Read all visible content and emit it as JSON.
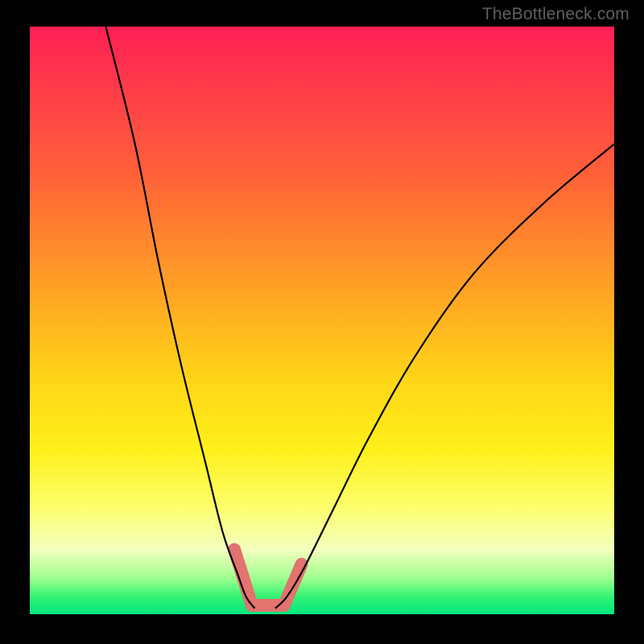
{
  "watermark": "TheBottleneck.com",
  "chart_data": {
    "type": "line",
    "title": "",
    "xlabel": "",
    "ylabel": "",
    "xlim": [
      0,
      100
    ],
    "ylim": [
      0,
      100
    ],
    "grid": false,
    "note": "V-shaped bottleneck curve on a red-to-green vertical gradient background. The plot has no visible axes or tick labels; values below are estimated from geometry (x and y as percentages of the plot box, y=0 at bottom/green, y=100 at top/red).",
    "series": [
      {
        "name": "left-branch",
        "x": [
          13.0,
          18.0,
          22.0,
          26.0,
          30.0,
          33.0,
          35.5,
          37.0,
          38.5
        ],
        "y": [
          100.0,
          80.0,
          60.0,
          42.0,
          26.0,
          14.0,
          7.0,
          3.0,
          1.0
        ]
      },
      {
        "name": "right-branch",
        "x": [
          42.0,
          44.0,
          47.0,
          52.0,
          58.0,
          66.0,
          76.0,
          88.0,
          100.0
        ],
        "y": [
          1.0,
          3.0,
          8.0,
          18.0,
          30.0,
          44.0,
          58.0,
          70.0,
          80.0
        ]
      }
    ],
    "marker_segments": {
      "note": "Thick salmon-pink marker overlay near the valley (approximate endpoints in plot-percent coords).",
      "color": "#e2736f",
      "segments": [
        {
          "x0": 35.0,
          "y0": 11.0,
          "x1": 38.0,
          "y1": 1.5
        },
        {
          "x0": 38.0,
          "y0": 1.5,
          "x1": 43.5,
          "y1": 1.5
        },
        {
          "x0": 43.5,
          "y0": 1.5,
          "x1": 46.5,
          "y1": 8.5
        }
      ]
    },
    "background_gradient": {
      "direction": "top-to-bottom",
      "stops": [
        {
          "pos": 0.0,
          "color": "#ff1f55"
        },
        {
          "pos": 0.25,
          "color": "#ff6038"
        },
        {
          "pos": 0.6,
          "color": "#ffd517"
        },
        {
          "pos": 0.82,
          "color": "#fdff6e"
        },
        {
          "pos": 0.94,
          "color": "#9cff8e"
        },
        {
          "pos": 1.0,
          "color": "#00e77f"
        }
      ]
    }
  }
}
